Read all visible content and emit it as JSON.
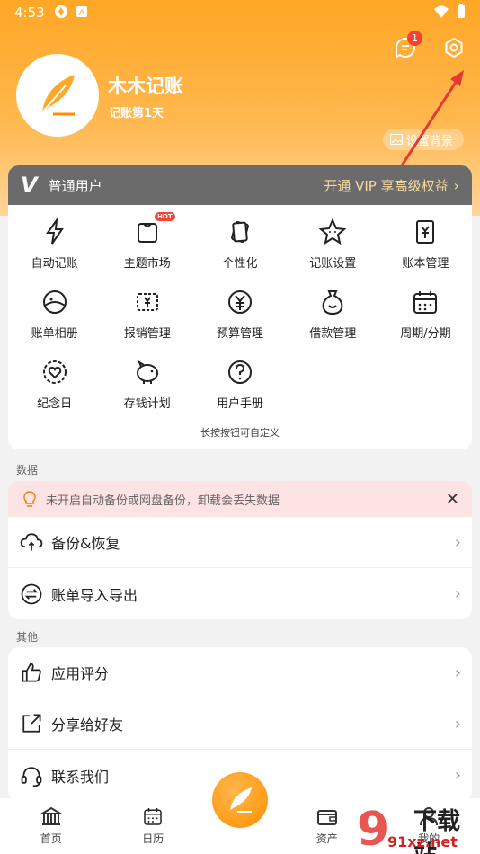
{
  "status_bar": {
    "time": "4:53"
  },
  "header": {
    "username": "木木记账",
    "days": "记账第1天",
    "message_badge": "1",
    "set_background": "设置背景"
  },
  "vip": {
    "user_type": "普通用户",
    "upgrade": "开通 VIP 享高级权益"
  },
  "features": [
    {
      "label": "自动记账",
      "icon": "lightning-icon"
    },
    {
      "label": "主题市场",
      "icon": "tshirt-icon",
      "badge": "HOT"
    },
    {
      "label": "个性化",
      "icon": "cards-icon"
    },
    {
      "label": "记账设置",
      "icon": "star-face-icon"
    },
    {
      "label": "账本管理",
      "icon": "yuan-book-icon"
    },
    {
      "label": "账单相册",
      "icon": "photo-icon"
    },
    {
      "label": "报销管理",
      "icon": "reimburse-icon"
    },
    {
      "label": "预算管理",
      "icon": "yuan-circle-icon"
    },
    {
      "label": "借款管理",
      "icon": "money-bag-icon"
    },
    {
      "label": "周期/分期",
      "icon": "calendar-icon"
    },
    {
      "label": "纪念日",
      "icon": "heart-badge-icon"
    },
    {
      "label": "存钱计划",
      "icon": "piggy-bank-icon"
    },
    {
      "label": "用户手册",
      "icon": "help-icon"
    }
  ],
  "grid_hint": "长按按钮可自定义",
  "data_section": {
    "title": "数据",
    "alert": "未开启自动备份或网盘备份，卸载会丢失数据",
    "items": [
      {
        "label": "备份&恢复",
        "icon": "cloud-sync-icon"
      },
      {
        "label": "账单导入导出",
        "icon": "transfer-icon"
      }
    ]
  },
  "other_section": {
    "title": "其他",
    "items": [
      {
        "label": "应用评分",
        "icon": "thumbs-up-icon"
      },
      {
        "label": "分享给好友",
        "icon": "share-icon"
      },
      {
        "label": "联系我们",
        "icon": "headset-icon"
      }
    ]
  },
  "bottom_nav": [
    {
      "label": "首页",
      "icon": "bank-icon"
    },
    {
      "label": "日历",
      "icon": "calendar-icon"
    },
    {
      "label": "资产",
      "icon": "wallet-icon"
    },
    {
      "label": "我的",
      "icon": "user-icon"
    }
  ],
  "watermark": {
    "text": "下载站",
    "url": "91xz.net"
  },
  "colors": {
    "accent": "#ffa726",
    "vip_gold": "#f7d9a1",
    "alert_bg": "#fde3e3"
  }
}
